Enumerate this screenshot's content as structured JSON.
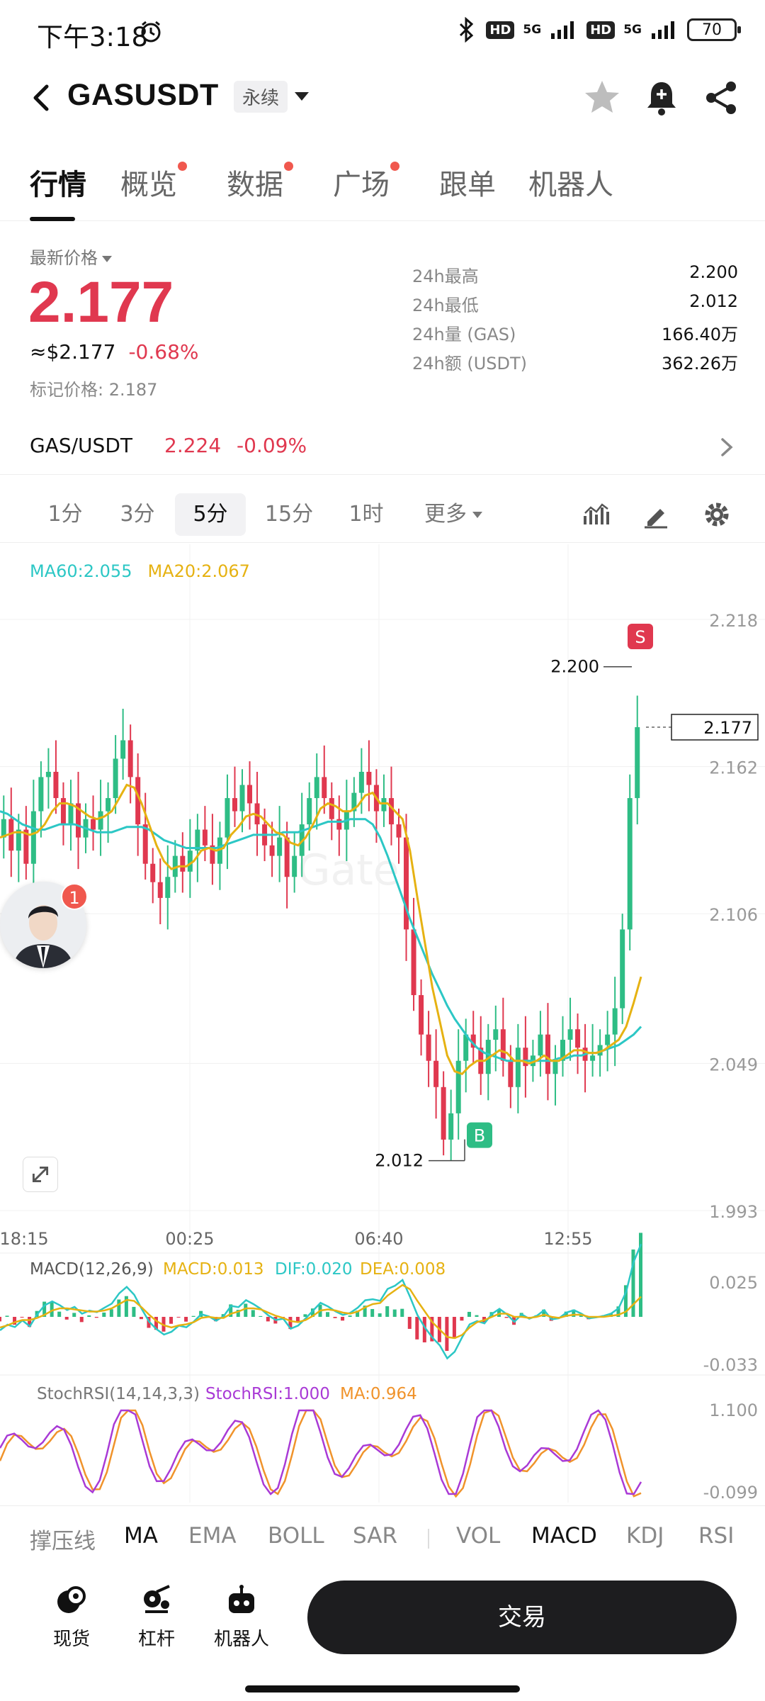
{
  "status_bar": {
    "time": "下午3:18",
    "net1": "5G",
    "net2": "5G",
    "battery": "70"
  },
  "header": {
    "title": "GASUSDT",
    "contract_type": "永续"
  },
  "tabs": [
    {
      "label": "行情",
      "active": true,
      "dot": false
    },
    {
      "label": "概览",
      "active": false,
      "dot": true
    },
    {
      "label": "数据",
      "active": false,
      "dot": true
    },
    {
      "label": "广场",
      "active": false,
      "dot": true
    },
    {
      "label": "跟单",
      "active": false,
      "dot": false
    },
    {
      "label": "机器人",
      "active": false,
      "dot": false
    }
  ],
  "price": {
    "label": "最新价格",
    "last": "2.177",
    "usd": "≈$2.177",
    "change": "-0.68%",
    "mark": "标记价格: 2.187"
  },
  "stats": [
    {
      "label": "24h最高",
      "value": "2.200"
    },
    {
      "label": "24h最低",
      "value": "2.012"
    },
    {
      "label": "24h量 (GAS)",
      "value": "166.40万"
    },
    {
      "label": "24h额 (USDT)",
      "value": "362.26万"
    }
  ],
  "spot": {
    "pair": "GAS/USDT",
    "price": "2.224",
    "change": "-0.09%"
  },
  "timeframes": [
    {
      "label": "1分",
      "active": false
    },
    {
      "label": "3分",
      "active": false
    },
    {
      "label": "5分",
      "active": true
    },
    {
      "label": "15分",
      "active": false
    },
    {
      "label": "1时",
      "active": false
    },
    {
      "label": "更多",
      "active": false
    }
  ],
  "ma_legend": {
    "ma60": "MA60:2.055",
    "ma20": "MA20:2.067"
  },
  "avatar_badge": "1",
  "chart_data": {
    "type": "candlestick",
    "colors": {
      "up": "#2ebd85",
      "down": "#e0384f",
      "ma60": "#2cc7c5",
      "ma20": "#e6b212",
      "dif": "#2cc7c5",
      "dea": "#e6b212",
      "stoch": "#a93ad6",
      "stoch_ma": "#f0932b"
    },
    "y_ticks": [
      "2.218",
      "2.162",
      "2.106",
      "2.049",
      "1.993"
    ],
    "ylim": [
      1.993,
      2.218
    ],
    "x_ticks": [
      "18:15",
      "00:25",
      "06:40",
      "12:55"
    ],
    "current_price": "2.177",
    "high_label": "2.200",
    "low_label": "2.012",
    "buy_marker": "B",
    "sell_marker": "S",
    "price_path": [
      2.135,
      2.142,
      2.13,
      2.138,
      2.125,
      2.145,
      2.158,
      2.16,
      2.15,
      2.14,
      2.148,
      2.135,
      2.142,
      2.138,
      2.145,
      2.15,
      2.165,
      2.172,
      2.158,
      2.14,
      2.125,
      2.118,
      2.112,
      2.12,
      2.128,
      2.122,
      2.13,
      2.138,
      2.132,
      2.125,
      2.135,
      2.15,
      2.145,
      2.155,
      2.148,
      2.14,
      2.132,
      2.128,
      2.135,
      2.12,
      2.128,
      2.14,
      2.15,
      2.158,
      2.15,
      2.142,
      2.138,
      2.145,
      2.152,
      2.16,
      2.155,
      2.145,
      2.15,
      2.14,
      2.135,
      2.1,
      2.075,
      2.06,
      2.05,
      2.04,
      2.02,
      2.03,
      2.05,
      2.06,
      2.055,
      2.045,
      2.058,
      2.062,
      2.05,
      2.04,
      2.055,
      2.048,
      2.052,
      2.06,
      2.045,
      2.05,
      2.058,
      2.062,
      2.055,
      2.05,
      2.052,
      2.056,
      2.06,
      2.07,
      2.1,
      2.15,
      2.177
    ],
    "ma60": [
      2.145,
      2.144,
      2.142,
      2.14,
      2.139,
      2.138,
      2.138,
      2.139,
      2.14,
      2.14,
      2.14,
      2.139,
      2.138,
      2.137,
      2.137,
      2.137,
      2.138,
      2.139,
      2.139,
      2.139,
      2.138,
      2.136,
      2.134,
      2.133,
      2.132,
      2.131,
      2.131,
      2.131,
      2.131,
      2.131,
      2.132,
      2.133,
      2.134,
      2.135,
      2.136,
      2.136,
      2.136,
      2.136,
      2.137,
      2.137,
      2.137,
      2.138,
      2.139,
      2.14,
      2.141,
      2.141,
      2.141,
      2.142,
      2.142,
      2.142,
      2.14,
      2.135,
      2.128,
      2.12,
      2.112,
      2.104,
      2.097,
      2.09,
      2.083,
      2.077,
      2.071,
      2.066,
      2.062,
      2.058,
      2.055,
      2.053,
      2.052,
      2.051,
      2.05,
      2.05,
      2.05,
      2.05,
      2.05,
      2.05,
      2.05,
      2.051,
      2.051,
      2.052,
      2.052,
      2.053,
      2.053,
      2.054,
      2.055,
      2.056,
      2.058,
      2.06,
      2.063
    ],
    "ma20": [
      2.135,
      2.136,
      2.137,
      2.137,
      2.136,
      2.137,
      2.14,
      2.145,
      2.148,
      2.148,
      2.147,
      2.145,
      2.143,
      2.142,
      2.143,
      2.145,
      2.15,
      2.155,
      2.154,
      2.148,
      2.14,
      2.132,
      2.126,
      2.123,
      2.124,
      2.124,
      2.126,
      2.13,
      2.131,
      2.13,
      2.131,
      2.136,
      2.139,
      2.143,
      2.144,
      2.143,
      2.14,
      2.137,
      2.136,
      2.133,
      2.132,
      2.135,
      2.14,
      2.146,
      2.148,
      2.147,
      2.145,
      2.145,
      2.147,
      2.151,
      2.152,
      2.148,
      2.148,
      2.145,
      2.142,
      2.13,
      2.112,
      2.095,
      2.078,
      2.065,
      2.052,
      2.046,
      2.045,
      2.048,
      2.05,
      2.05,
      2.052,
      2.054,
      2.053,
      2.05,
      2.05,
      2.049,
      2.05,
      2.052,
      2.05,
      2.05,
      2.052,
      2.054,
      2.054,
      2.053,
      2.053,
      2.054,
      2.056,
      2.058,
      2.063,
      2.072,
      2.082
    ],
    "macd_legend": {
      "name": "MACD(12,26,9)",
      "macd": "MACD:0.013",
      "dif": "DIF:0.020",
      "dea": "DEA:0.008"
    },
    "macd_ticks": [
      "0.025",
      "-0.033"
    ],
    "stoch_legend": {
      "name": "StochRSI(14,14,3,3)",
      "stoch": "StochRSI:1.000",
      "ma": "MA:0.964"
    },
    "stoch_ticks": [
      "1.100",
      "-0.099"
    ]
  },
  "indicators": [
    "撑压线",
    "MA",
    "EMA",
    "BOLL",
    "SAR",
    "VOL",
    "MACD",
    "KDJ",
    "RSI"
  ],
  "bottom_nav": {
    "spot": "现货",
    "leverage": "杠杆",
    "bot": "机器人",
    "trade": "交易"
  }
}
